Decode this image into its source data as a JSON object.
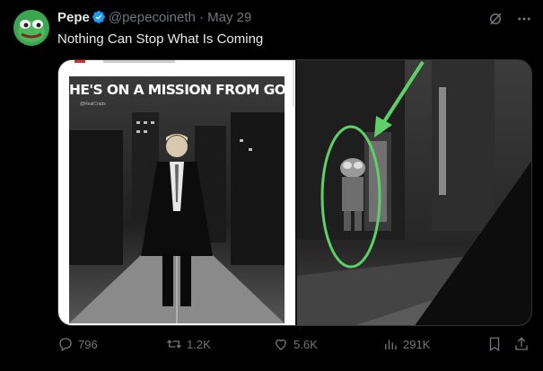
{
  "author": {
    "name": "Pepe",
    "handle": "@pepecoineth",
    "separator": "·",
    "date": "May 29"
  },
  "tweet": {
    "text": "Nothing Can Stop What Is Coming"
  },
  "media": {
    "left_image": {
      "poster_title": "HE'S ON A MISSION FROM GOD",
      "poster_handle": "@RealCrads"
    }
  },
  "actions": {
    "replies": "796",
    "reposts": "1.2K",
    "likes": "5.6K",
    "views": "291K"
  },
  "colors": {
    "background": "#000000",
    "text": "#e7e9ea",
    "muted": "#71767b",
    "verified": "#1d9bf0",
    "annotation_green": "#5fd068"
  },
  "icons": {
    "verified": "verified-badge-icon",
    "grok": "grok-icon",
    "more": "more-icon",
    "reply": "reply-icon",
    "repost": "repost-icon",
    "like": "like-icon",
    "views": "views-icon",
    "bookmark": "bookmark-icon",
    "share": "share-icon"
  }
}
